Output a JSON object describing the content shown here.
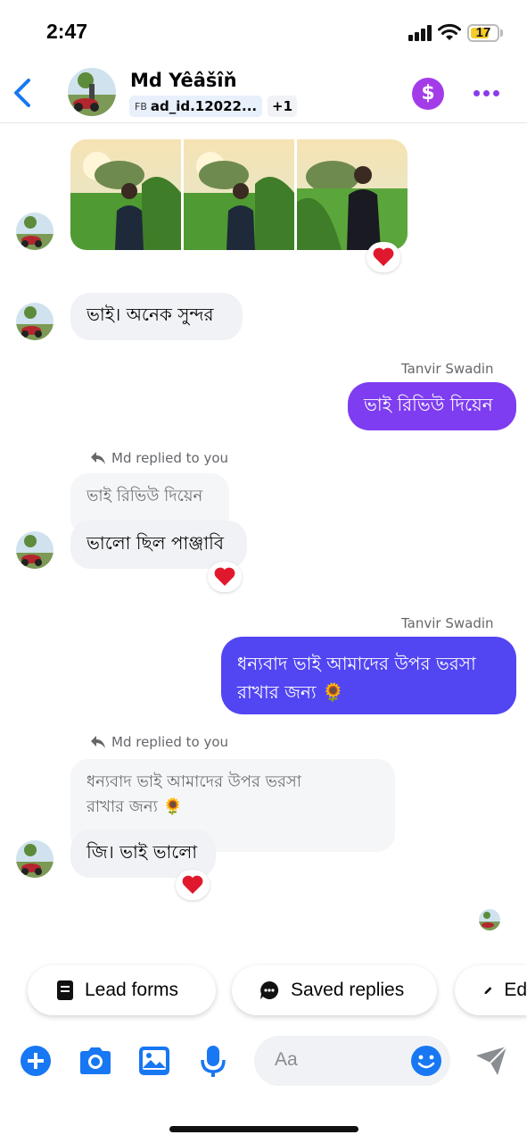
{
  "status_bar": {
    "time": "2:47",
    "battery": "17"
  },
  "header": {
    "name": "Md Yêâšîň",
    "fb_label": "FB",
    "ad_id": "ad_id.12022...",
    "extra_count": "+1",
    "dollar_symbol": "$"
  },
  "messages": {
    "m1_text": "ভাই। অনেক সুন্দর",
    "sender_1": "Tanvir Swadin",
    "out_1": "ভাই রিভিউ দিয়েন",
    "reply_label_1": "Md replied to you",
    "quote_1": "ভাই রিভিউ দিয়েন",
    "m2_text": "ভালো ছিল পাঞ্জাবি",
    "sender_2": "Tanvir Swadin",
    "out_2_line1": "ধন্যবাদ ভাই আমাদের উপর ভরসা",
    "out_2_line2": "রাখার জন্য 🌻",
    "reply_label_2": "Md replied to you",
    "quote_2_line1": "ধন্যবাদ ভাই আমাদের উপর ভরসা",
    "quote_2_line2": "রাখার জন্য 🌻",
    "m3_text": "জি। ভাই ভালো",
    "reaction_emoji": "❤️"
  },
  "quick_replies": {
    "lead_forms": "Lead forms",
    "saved_replies": "Saved replies",
    "edit": "Ed"
  },
  "composer": {
    "placeholder": "Aa"
  },
  "colors": {
    "accent": "#7e3df0",
    "blue_bubble": "#5245f2",
    "icon_blue": "#1877f2",
    "purple": "#a33ce8"
  }
}
